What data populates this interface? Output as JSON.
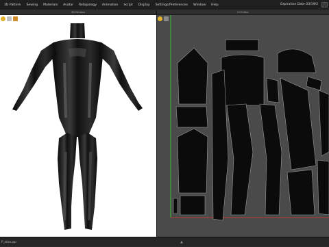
{
  "menu": {
    "items": [
      "3D Pattern",
      "Sewing",
      "Materials",
      "Avatar",
      "Retopology",
      "Animation",
      "Script",
      "Display",
      "Settings/Preferences",
      "Window",
      "Help"
    ],
    "expiration": "Expiration Date 03/19/2"
  },
  "panels": {
    "left_title": "3D Window",
    "right_title": "UV Editor"
  },
  "status": {
    "file_name": "P_skins.zpr",
    "center_arrow": "▲"
  },
  "colors": {
    "viewport_bg": "#ffffff",
    "uv_bg": "#4a4a4a",
    "uv_shell_fill": "#0b0b0b",
    "uv_shell_stroke": "#9a9a9a",
    "axis_green": "#3bbf3b",
    "axis_red": "#c03838",
    "toolbar_icon_yellow": "#e0b030"
  }
}
